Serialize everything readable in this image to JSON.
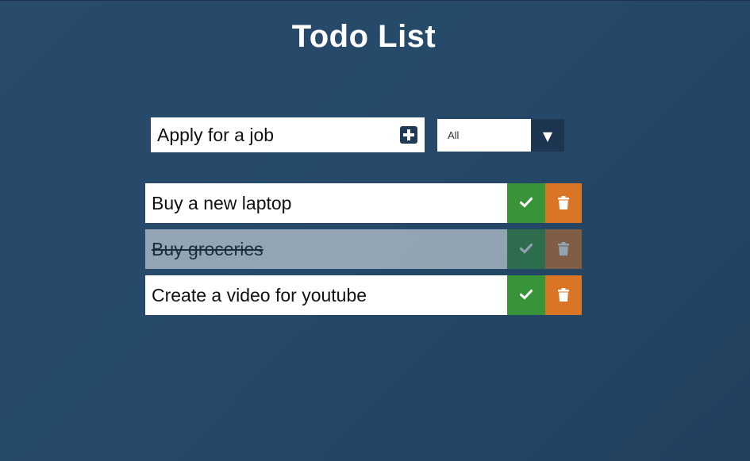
{
  "app": {
    "title": "Todo List"
  },
  "form": {
    "input_value": "Apply for a job",
    "add_icon": "plus-square-icon",
    "filter": {
      "selected": "All",
      "arrow": "▼"
    }
  },
  "todos": [
    {
      "text": "Buy a new laptop",
      "completed": false
    },
    {
      "text": "Buy groceries",
      "completed": true
    },
    {
      "text": "Create a video for youtube",
      "completed": false
    }
  ],
  "icons": {
    "complete": "check-icon",
    "delete": "trash-icon"
  },
  "colors": {
    "background": "#284b6b",
    "complete_button": "#399338",
    "trash_button": "#db7526",
    "accent_dark": "#1c3652"
  }
}
